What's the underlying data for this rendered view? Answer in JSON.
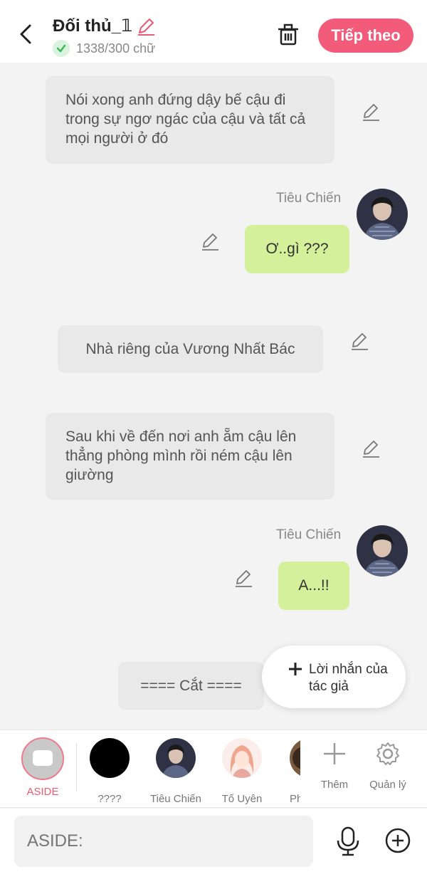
{
  "header": {
    "title": "Đối thủ_𝟙",
    "word_count": "1338/300 chữ",
    "next_label": "Tiếp theo"
  },
  "messages": [
    {
      "type": "narration",
      "text": "Nói xong anh đứng dậy bế cậu đi trong sự ngơ ngác của cậu và tất cả mọi người ở đó"
    },
    {
      "type": "dialogue",
      "author": "Tiêu Chiến",
      "text": "Ơ..gì ???"
    },
    {
      "type": "narration",
      "text": "Nhà riêng của Vương Nhất Bác"
    },
    {
      "type": "narration",
      "text": "Sau khi về đến nơi anh ẵm cậu lên thẳng phòng mình rồi ném cậu lên giường"
    },
    {
      "type": "dialogue",
      "author": "Tiêu Chiến",
      "text": "A...!!"
    },
    {
      "type": "narration",
      "text": "==== Cắt ===="
    }
  ],
  "fab": {
    "label": "Lời nhắn của tác giả"
  },
  "characters": [
    {
      "name": "ASIDE",
      "active": true
    },
    {
      "name": "????"
    },
    {
      "name": "Tiêu Chiến"
    },
    {
      "name": "Tố Uyên"
    },
    {
      "name": "Ph"
    }
  ],
  "tools": {
    "add_label": "Thêm",
    "manage_label": "Quản lý"
  },
  "input": {
    "placeholder": "ASIDE:"
  },
  "colors": {
    "accent": "#f25c7a",
    "bubble_green": "#d4f09a",
    "bubble_gray": "#e9e9e9"
  }
}
